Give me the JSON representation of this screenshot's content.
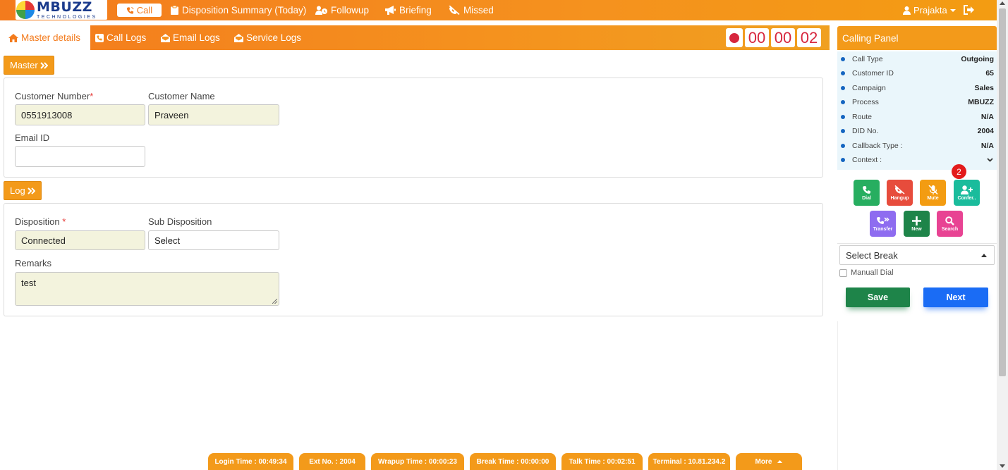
{
  "logo": {
    "name": "MBUZZ",
    "sub": "TECHNOLOGIES"
  },
  "topbar": {
    "call_label": "Call",
    "nav": [
      "Disposition Summary (Today)",
      "Followup",
      "Briefing",
      "Missed"
    ],
    "user_name": "Prajakta"
  },
  "tabs": [
    "Master details",
    "Call Logs",
    "Email Logs",
    "Service Logs"
  ],
  "timer": [
    "00",
    "00",
    "02"
  ],
  "master": {
    "section_label": "Master",
    "customer_number_label": "Customer Number",
    "customer_number": "0551913008",
    "customer_name_label": "Customer Name",
    "customer_name": "Praveen",
    "email_label": "Email ID",
    "email": ""
  },
  "log": {
    "section_label": "Log",
    "disposition_label": "Disposition",
    "disposition": "Connected",
    "sub_disposition_label": "Sub Disposition",
    "sub_disposition": "Select",
    "remarks_label": "Remarks",
    "remarks": "test"
  },
  "calling_panel": {
    "title": "Calling Panel",
    "rows": [
      {
        "label": "Call Type",
        "value": "Outgoing"
      },
      {
        "label": "Customer ID",
        "value": "65"
      },
      {
        "label": "Campaign",
        "value": "Sales"
      },
      {
        "label": "Process",
        "value": "MBUZZ"
      },
      {
        "label": "Route",
        "value": "N/A"
      },
      {
        "label": "DID No.",
        "value": "2004"
      },
      {
        "label": "Callback Type :",
        "value": "N/A"
      },
      {
        "label": "Context :",
        "value": ""
      }
    ],
    "actions": [
      "Dial",
      "Hangup",
      "Mute",
      "Confer..",
      "Transfer",
      "New",
      "Search"
    ],
    "conference_badge": "2",
    "break_placeholder": "Select Break",
    "manual_dial_label": "Manuall Dial",
    "save_label": "Save",
    "next_label": "Next"
  },
  "footer": [
    "Login Time : 00:49:34",
    "Ext No. : 2004",
    "Wrapup Time : 00:00:23",
    "Break Time : 00:00:00",
    "Talk Time : 00:02:51",
    "Terminal : 10.81.234.2",
    "More"
  ],
  "colors": {
    "brand_orange": "#f37b1d",
    "panel_orange": "#f39a1a",
    "dial_green": "#27ae60",
    "hangup_red": "#e74c3c",
    "mute_orange": "#f39c12",
    "confer_teal": "#1abc9c",
    "transfer_purple": "#8e6cf0",
    "new_green": "#1e8449",
    "search_pink": "#e84393",
    "save_green": "#1e8449",
    "next_blue": "#1a6cf5"
  }
}
